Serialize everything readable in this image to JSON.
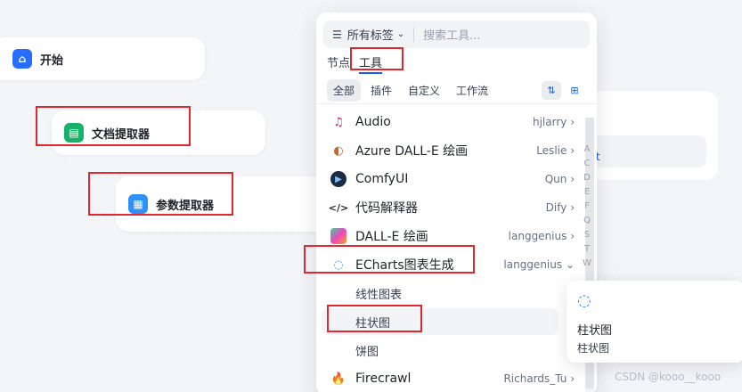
{
  "canvas_nodes": {
    "start": {
      "label": "开始",
      "color": "#296dff"
    },
    "doc_extractor": {
      "label": "文档提取器",
      "color": "#17b26a"
    },
    "param_extractor": {
      "label": "参数提取器",
      "color": "#2e90fa"
    }
  },
  "panel": {
    "tag_filter": "所有标签",
    "search_placeholder": "搜索工具...",
    "tabs": {
      "node": "节点",
      "tools": "工具"
    },
    "filters": [
      "全部",
      "插件",
      "自定义",
      "工作流"
    ],
    "az_index": [
      "A",
      "C",
      "D",
      "E",
      "F",
      "Q",
      "S",
      "T",
      "W"
    ],
    "tools": [
      {
        "name": "Audio",
        "author": "hjlarry",
        "icon": "audio-icon"
      },
      {
        "name": "Azure DALL-E 绘画",
        "author": "Leslie",
        "icon": "azure-dalle-icon"
      },
      {
        "name": "ComfyUI",
        "author": "Qun",
        "icon": "comfyui-icon"
      },
      {
        "name": "代码解释器",
        "author": "Dify",
        "icon": "code-icon"
      },
      {
        "name": "DALL-E 绘画",
        "author": "langgenius",
        "icon": "dalle-icon"
      },
      {
        "name": "ECharts图表生成",
        "author": "langgenius",
        "icon": "echarts-icon"
      }
    ],
    "echarts_subtools": [
      "线性图表",
      "柱状图",
      "饼图"
    ],
    "last_tool": {
      "name": "Firecrawl",
      "author": "Richards_Tu",
      "icon": "firecrawl-icon"
    }
  },
  "tooltip": {
    "title": "柱状图",
    "desc": "柱状图"
  },
  "bg_card": {
    "letter": "t"
  },
  "watermark": "CSDN @kooo__kooo",
  "accent_color": "#155eef",
  "annotation_color": "#e0282e"
}
